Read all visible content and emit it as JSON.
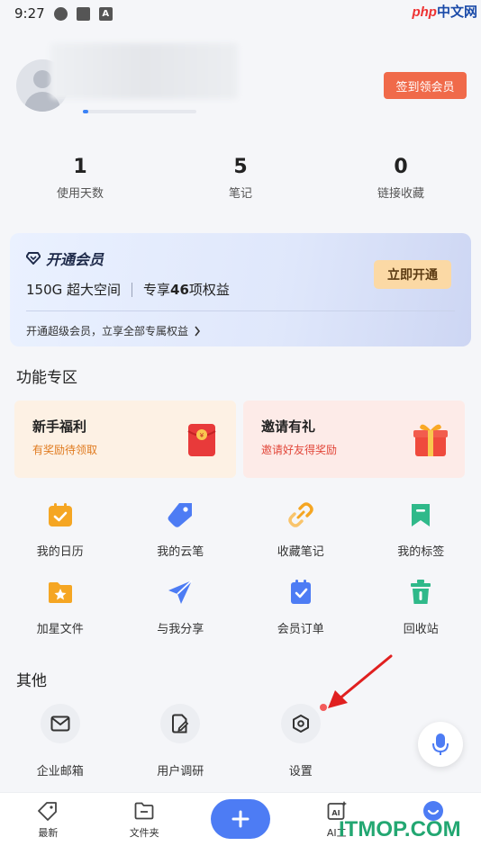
{
  "status_bar": {
    "time": "9:27"
  },
  "watermark_top": {
    "latin": "php",
    "cn": "中文网"
  },
  "profile": {
    "checkin_label": "签到领会员",
    "level_progress": 0.05
  },
  "stats": [
    {
      "value": "1",
      "label": "使用天数"
    },
    {
      "value": "5",
      "label": "笔记"
    },
    {
      "value": "0",
      "label": "链接收藏"
    }
  ],
  "vip": {
    "title": "开通会员",
    "space": "150G 超大空间",
    "benefit_prefix": "专享",
    "benefit_count": "46",
    "benefit_suffix": "项权益",
    "open_label": "立即开通",
    "footer": "开通超级会员，立享全部专属权益"
  },
  "features": {
    "title": "功能专区",
    "promos": [
      {
        "title": "新手福利",
        "subtitle": "有奖励待领取"
      },
      {
        "title": "邀请有礼",
        "subtitle": "邀请好友得奖励"
      }
    ],
    "grid": [
      {
        "label": "我的日历",
        "icon": "calendar-icon",
        "color": "#f5a623"
      },
      {
        "label": "我的云笔",
        "icon": "pen-tag-icon",
        "color": "#4d7cf4"
      },
      {
        "label": "收藏笔记",
        "icon": "link-icon",
        "color": "#f5a623"
      },
      {
        "label": "我的标签",
        "icon": "bookmark-icon",
        "color": "#2fb98a"
      },
      {
        "label": "加星文件",
        "icon": "star-folder-icon",
        "color": "#f5a623"
      },
      {
        "label": "与我分享",
        "icon": "send-icon",
        "color": "#4d7cf4"
      },
      {
        "label": "会员订单",
        "icon": "order-icon",
        "color": "#4d7cf4"
      },
      {
        "label": "回收站",
        "icon": "trash-icon",
        "color": "#2fb98a"
      }
    ]
  },
  "others": {
    "title": "其他",
    "items": [
      {
        "label": "企业邮箱",
        "icon": "mail-icon"
      },
      {
        "label": "用户调研",
        "icon": "survey-icon"
      },
      {
        "label": "设置",
        "icon": "settings-hex-icon"
      }
    ]
  },
  "bottom_nav": [
    {
      "label": "最新",
      "icon": "tag-icon"
    },
    {
      "label": "文件夹",
      "icon": "folder-icon"
    },
    {
      "label": "",
      "icon": "plus-icon"
    },
    {
      "label": "AI工",
      "icon": "ai-icon"
    },
    {
      "label": "",
      "icon": "me-icon"
    }
  ],
  "watermark_bottom": "ITMOP.COM",
  "colors": {
    "accent": "#4d7cf4",
    "checkin": "#f06a4a",
    "vip_button": "#fbd9a5",
    "arrow": "#e02020"
  }
}
